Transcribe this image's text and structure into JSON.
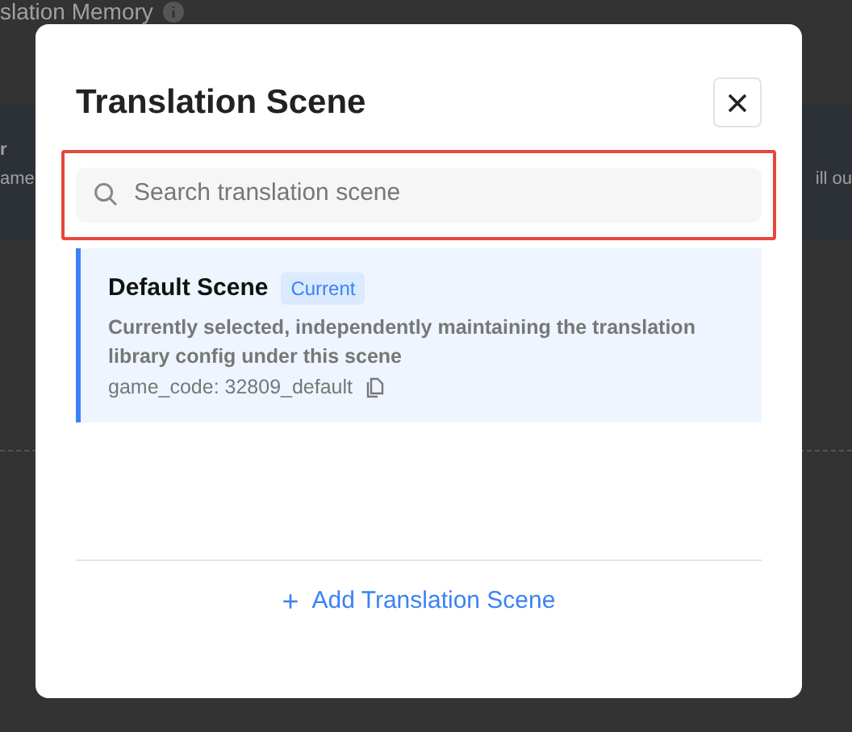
{
  "background_page": {
    "title": "slation Memory",
    "fragments": [
      "r",
      "ame",
      "ill ou"
    ]
  },
  "dialog": {
    "title": "Translation Scene",
    "search": {
      "placeholder": "Search translation scene",
      "highlighted": true
    },
    "scenes": [
      {
        "name": "Default Scene",
        "badge": "Current",
        "description": "Currently selected, independently maintaining the translation library config under this scene",
        "code": "game_code: 32809_default",
        "selected": true
      }
    ],
    "add_button": {
      "icon": "+",
      "label": "Add Translation Scene"
    }
  }
}
